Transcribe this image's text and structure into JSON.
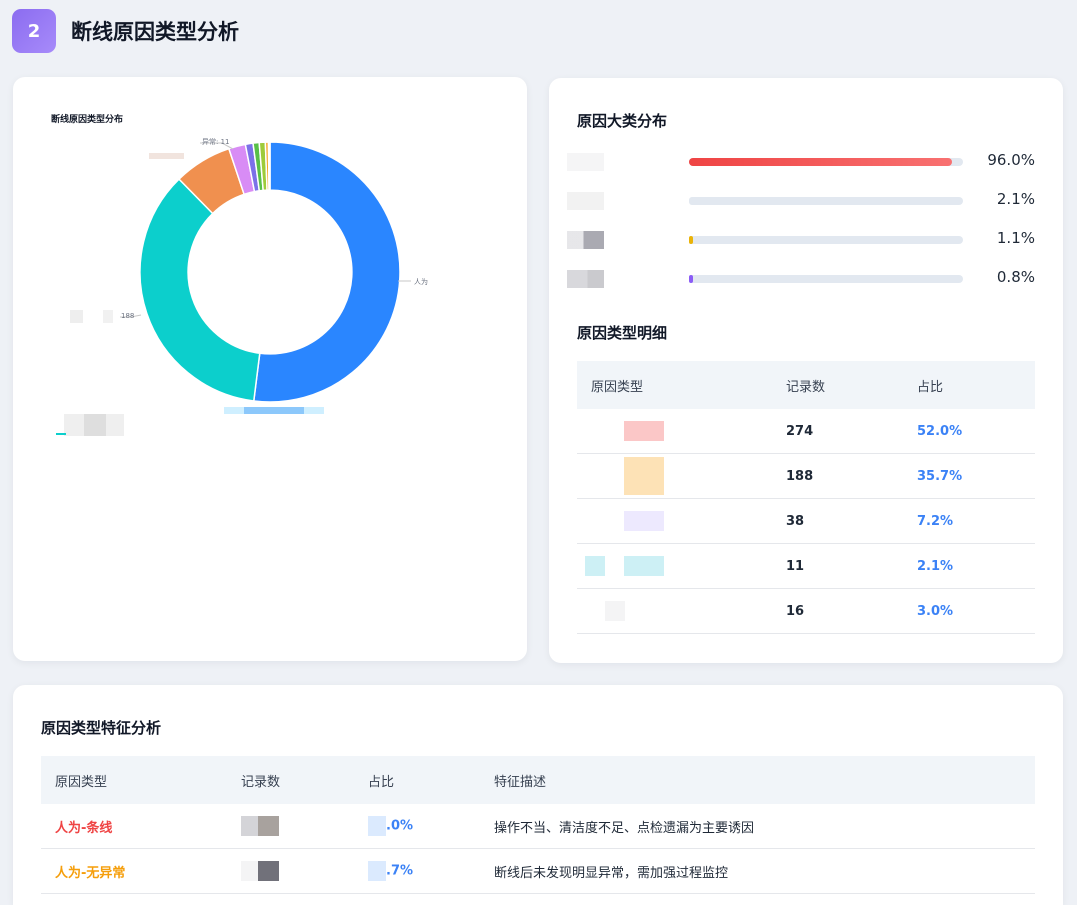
{
  "header": {
    "number": "2",
    "title": "断线原因类型分析"
  },
  "donut_card": {
    "label_top": "异常: 11",
    "label_left": "188",
    "label_right": "人为"
  },
  "chart_data": {
    "type": "pie",
    "title": "断线原因类型分布",
    "values": [
      274,
      188,
      38,
      11,
      5,
      4,
      4,
      2,
      1
    ],
    "colors": [
      "#2a86ff",
      "#0ccfcc",
      "#f0904f",
      "#d88cf5",
      "#7b71e8",
      "#58bf48",
      "#9ecb3a",
      "#f5a623",
      "#a0a0a0"
    ],
    "inner_radius_fraction": 0.63
  },
  "dist_card": {
    "title": "原因大类分布",
    "rows": [
      {
        "value": 96.0,
        "pct": "96.0%",
        "color": "#ef4444"
      },
      {
        "value": 2.1,
        "pct": "2.1%",
        "color": "#e2e8f0"
      },
      {
        "value": 1.1,
        "pct": "1.1%",
        "color": "#eab308"
      },
      {
        "value": 0.8,
        "pct": "0.8%",
        "color": "#8b5cf6"
      }
    ]
  },
  "detail_table": {
    "title": "原因类型明细",
    "headers": [
      "原因类型",
      "记录数",
      "占比"
    ],
    "rows": [
      {
        "count": "274",
        "pct": "52.0%",
        "swatch": "#fbc7c7"
      },
      {
        "count": "188",
        "pct": "35.7%",
        "swatch": "#fde2b6"
      },
      {
        "count": "38",
        "pct": "7.2%",
        "swatch": "#ede9fe"
      },
      {
        "count": "11",
        "pct": "2.1%",
        "swatch": "#cdf0f5"
      },
      {
        "count": "16",
        "pct": "3.0%",
        "swatch": "#f1f5f9"
      }
    ]
  },
  "feature_table": {
    "title": "原因类型特征分析",
    "headers": [
      "原因类型",
      "记录数",
      "占比",
      "特征描述"
    ],
    "rows": [
      {
        "name": "人为-条线",
        "name_color": "#ef4444",
        "pct": ".0%",
        "desc": "操作不当、清洁度不足、点检遗漏为主要诱因"
      },
      {
        "name": "人为-无异常",
        "name_color": "#f59e0b",
        "pct": ".7%",
        "desc": "断线后未发现明显异常，需加强过程监控"
      }
    ]
  }
}
